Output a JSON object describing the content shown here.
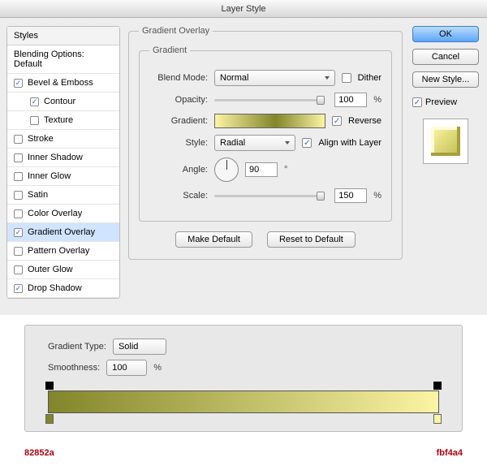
{
  "window": {
    "title": "Layer Style"
  },
  "styles_panel": {
    "header": "Styles",
    "blending_options_label": "Blending Options: Default",
    "items": [
      {
        "label": "Bevel & Emboss",
        "checked": true,
        "selected": false
      },
      {
        "label": "Contour",
        "checked": true,
        "selected": false,
        "indent": true
      },
      {
        "label": "Texture",
        "checked": false,
        "selected": false,
        "indent": true
      },
      {
        "label": "Stroke",
        "checked": false,
        "selected": false
      },
      {
        "label": "Inner Shadow",
        "checked": false,
        "selected": false
      },
      {
        "label": "Inner Glow",
        "checked": false,
        "selected": false
      },
      {
        "label": "Satin",
        "checked": false,
        "selected": false
      },
      {
        "label": "Color Overlay",
        "checked": false,
        "selected": false
      },
      {
        "label": "Gradient Overlay",
        "checked": true,
        "selected": true
      },
      {
        "label": "Pattern Overlay",
        "checked": false,
        "selected": false
      },
      {
        "label": "Outer Glow",
        "checked": false,
        "selected": false
      },
      {
        "label": "Drop Shadow",
        "checked": true,
        "selected": false
      }
    ]
  },
  "gradient_overlay": {
    "group_title": "Gradient Overlay",
    "inner_title": "Gradient",
    "blend_mode": {
      "label": "Blend Mode:",
      "value": "Normal"
    },
    "dither": {
      "label": "Dither",
      "checked": false
    },
    "opacity": {
      "label": "Opacity:",
      "value": "100",
      "unit": "%"
    },
    "gradient_label": "Gradient:",
    "reverse": {
      "label": "Reverse",
      "checked": true
    },
    "style": {
      "label": "Style:",
      "value": "Radial"
    },
    "align": {
      "label": "Align with Layer",
      "checked": true
    },
    "angle": {
      "label": "Angle:",
      "value": "90",
      "unit": "°"
    },
    "scale": {
      "label": "Scale:",
      "value": "150",
      "unit": "%"
    },
    "make_default": "Make Default",
    "reset_default": "Reset to Default"
  },
  "right": {
    "ok": "OK",
    "cancel": "Cancel",
    "new_style": "New Style...",
    "preview": {
      "label": "Preview",
      "checked": true
    }
  },
  "gradient_editor": {
    "type": {
      "label": "Gradient Type:",
      "value": "Solid"
    },
    "smoothness": {
      "label": "Smoothness:",
      "value": "100",
      "unit": "%"
    },
    "stops": {
      "left_color": "#82852a",
      "right_color": "#fbf4a4"
    }
  },
  "color_codes": {
    "left": "82852a",
    "right": "fbf4a4"
  }
}
